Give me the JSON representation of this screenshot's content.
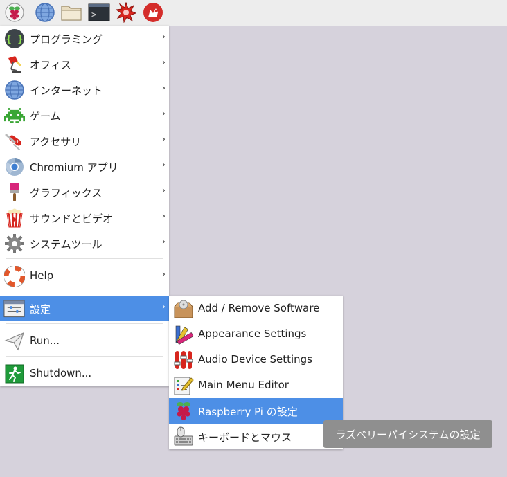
{
  "taskbar": {
    "icons": [
      "raspberry-icon",
      "globe-icon",
      "folder-icon",
      "terminal-icon",
      "burst-icon",
      "wolfram-icon"
    ],
    "terminal_glyph": ">_"
  },
  "main_menu": {
    "items": [
      {
        "label": "プログラミング",
        "icon": "code-braces-icon",
        "arrow": "›"
      },
      {
        "label": "オフィス",
        "icon": "desk-lamp-icon",
        "arrow": "›"
      },
      {
        "label": "インターネット",
        "icon": "globe-icon",
        "arrow": "›"
      },
      {
        "label": "ゲーム",
        "icon": "space-invader-icon",
        "arrow": "›"
      },
      {
        "label": "アクセサリ",
        "icon": "pocket-knife-icon",
        "arrow": "›"
      },
      {
        "label": "Chromium アプリ",
        "icon": "chromium-icon",
        "arrow": "›"
      },
      {
        "label": "グラフィックス",
        "icon": "paintbrush-icon",
        "arrow": "›"
      },
      {
        "label": "サウンドとビデオ",
        "icon": "popcorn-icon",
        "arrow": "›"
      },
      {
        "label": "システムツール",
        "icon": "gear-icon",
        "arrow": "›"
      },
      {
        "label": "Help",
        "icon": "lifebuoy-icon",
        "arrow": "›"
      },
      {
        "label": "設定",
        "icon": "settings-panel-icon",
        "arrow": "›"
      },
      {
        "label": "Run...",
        "icon": "paper-plane-icon"
      },
      {
        "label": "Shutdown...",
        "icon": "exit-runner-icon"
      }
    ]
  },
  "settings_submenu": {
    "items": [
      {
        "label": "Add / Remove Software",
        "icon": "package-icon"
      },
      {
        "label": "Appearance Settings",
        "icon": "color-palette-icon"
      },
      {
        "label": "Audio Device Settings",
        "icon": "audio-sliders-icon"
      },
      {
        "label": "Main Menu Editor",
        "icon": "menu-editor-icon"
      },
      {
        "label": "Raspberry Pi の設定",
        "icon": "raspberry-icon"
      },
      {
        "label": "キーボードとマウス",
        "icon": "keyboard-mouse-icon"
      }
    ]
  },
  "tooltip": {
    "text": "ラズベリーパイシステムの設定"
  },
  "colors": {
    "highlight": "#4d8fe6",
    "desktop": "#d6d2dc",
    "tooltip": "#8f8f8f"
  }
}
